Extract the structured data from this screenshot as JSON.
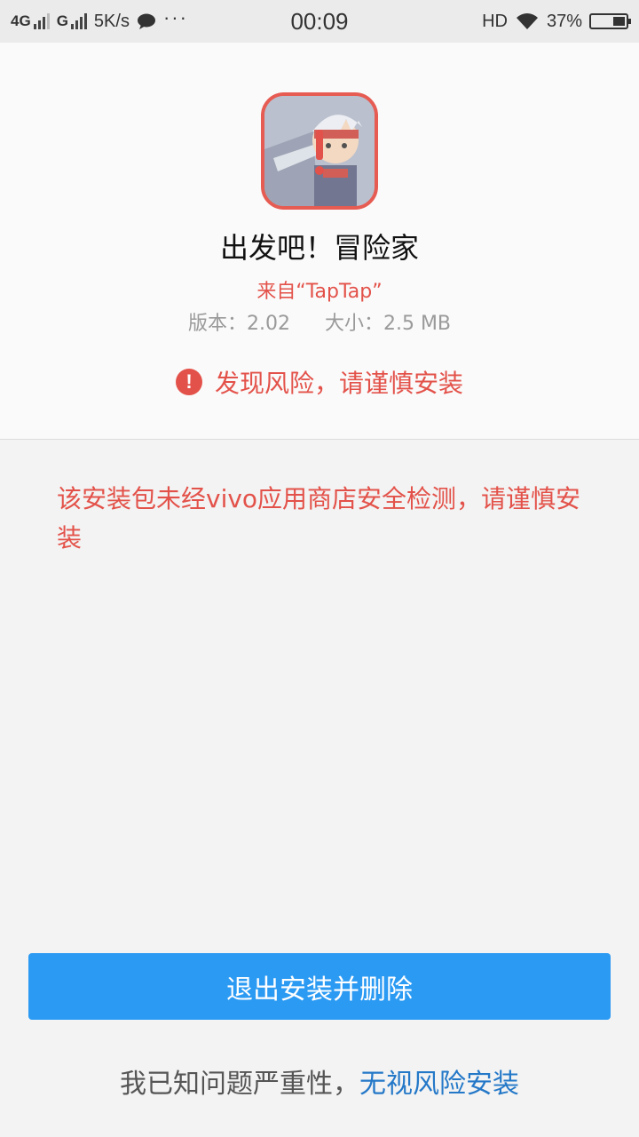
{
  "status_bar": {
    "network1": "4G",
    "network2": "G",
    "speed": "5K/s",
    "more": "···",
    "time": "00:09",
    "hd": "HD",
    "battery": "37%",
    "battery_level": 0.37,
    "icons": [
      "signal-icon",
      "chat-icon",
      "wifi-icon",
      "battery-icon"
    ]
  },
  "app": {
    "name": "出发吧！冒险家",
    "source": "来自“TapTap”",
    "version": "版本：2.02",
    "size": "大小：2.5 MB",
    "icon": "app-game-icon"
  },
  "risk": {
    "message": "发现风险，请谨慎安装",
    "icon_glyph": "!"
  },
  "warning_text": "该安装包未经vivo应用商店安全检测，请谨慎安装",
  "actions": {
    "exit_button": "退出安装并删除",
    "footer_prefix": "我已知问题严重性，",
    "ignore_link": "无视风险安装"
  },
  "colors": {
    "accent_blue": "#2b9af3",
    "danger_red": "#e3524a",
    "link_blue": "#2478c8"
  }
}
